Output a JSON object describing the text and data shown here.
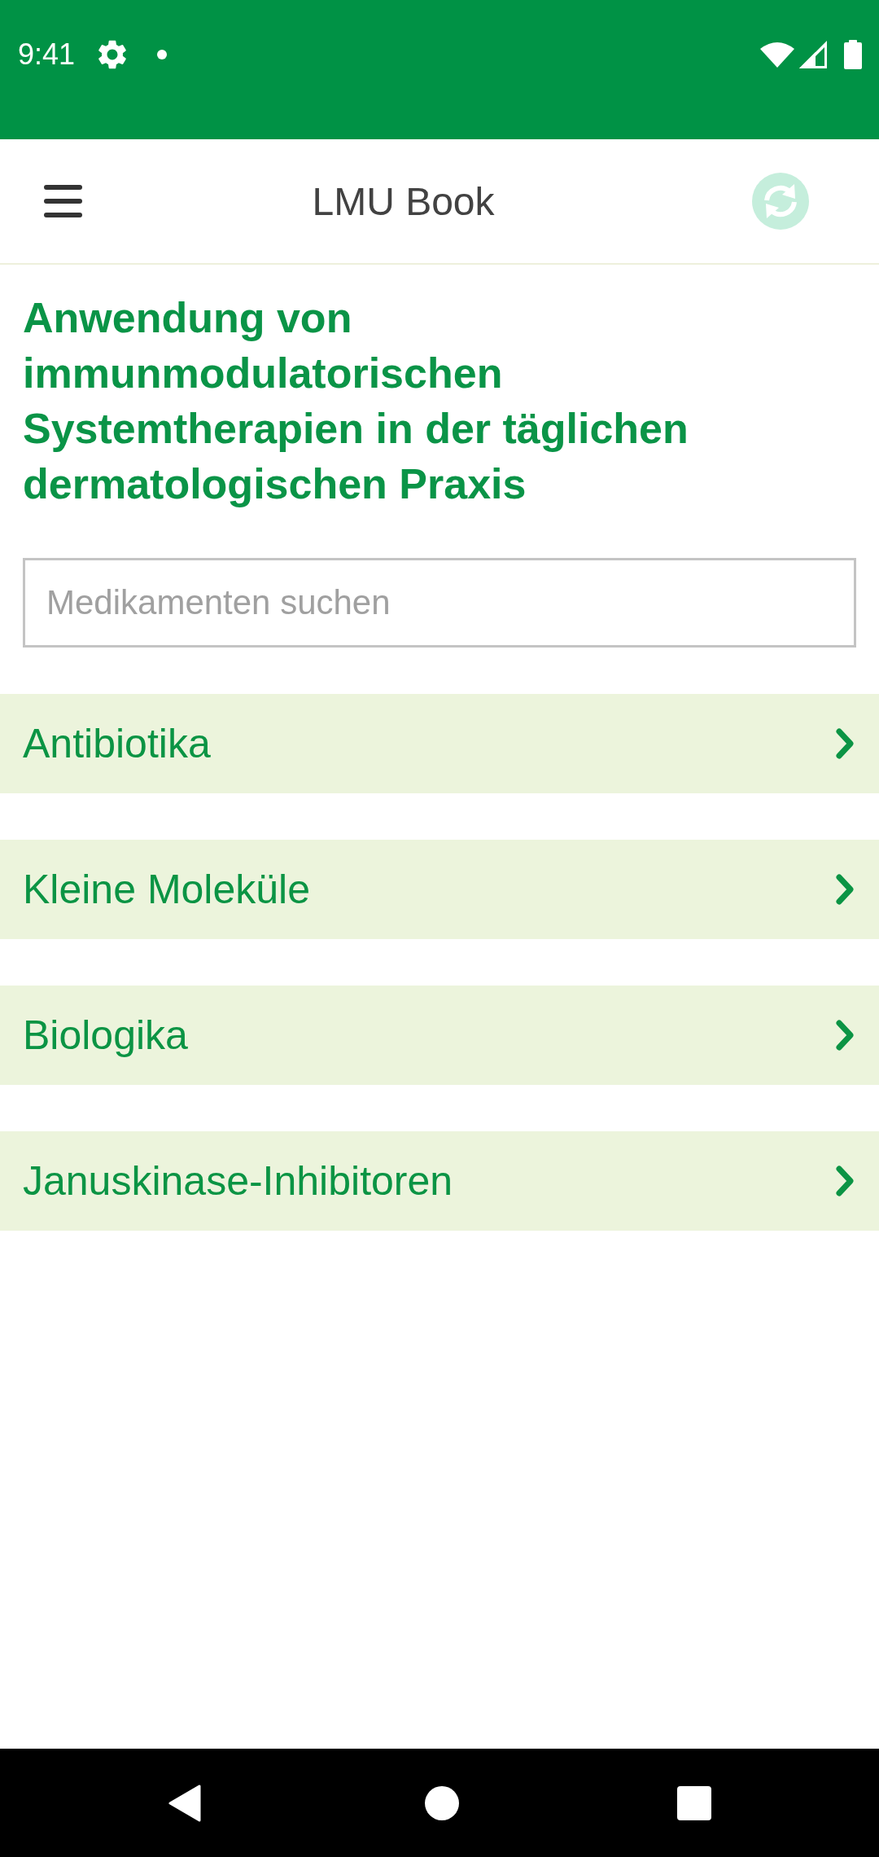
{
  "status_bar": {
    "time": "9:41"
  },
  "app_bar": {
    "title": "LMU Book"
  },
  "heading": "Anwendung von immunmodulatorischen Systemtherapien in der täglichen dermatologischen Praxis",
  "search": {
    "placeholder": "Medikamenten suchen"
  },
  "categories": [
    {
      "label": "Antibiotika"
    },
    {
      "label": "Kleine Moleküle"
    },
    {
      "label": "Biologika"
    },
    {
      "label": "Januskinase-Inhibitoren"
    }
  ]
}
